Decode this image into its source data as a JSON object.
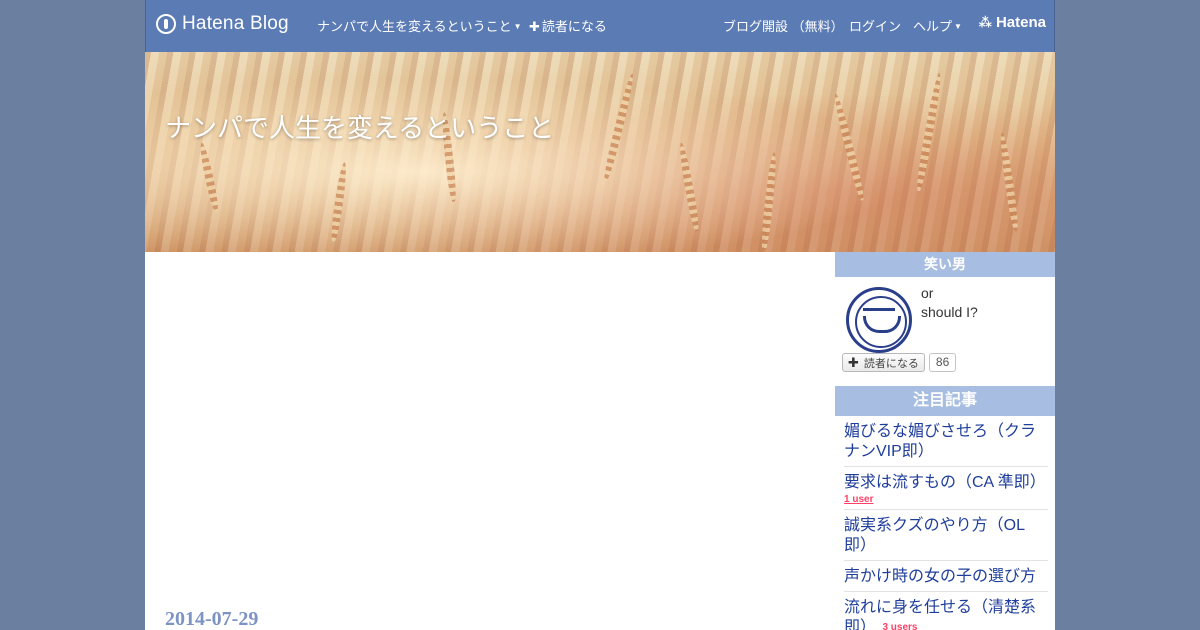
{
  "topbar": {
    "brand": "Hatena Blog",
    "blog_menu": "ナンパで人生を変えるということ",
    "subscribe": "読者になる",
    "start_blog": "ブログ開設 （無料）",
    "login": "ログイン",
    "help": "ヘルプ",
    "hatena": "Hatena"
  },
  "header": {
    "title": "ナンパで人生を変えるということ"
  },
  "main": {
    "date": "2014-07-29"
  },
  "sidebar": {
    "profile": {
      "title": "笑い男",
      "desc_line1": "or",
      "desc_line2": "should I?",
      "subscribe_label": "読者になる",
      "subscriber_count": "86"
    },
    "entries": {
      "title": "注目記事",
      "items": [
        {
          "title": "媚びるな媚びさせろ（クラナンVIP即）",
          "users": ""
        },
        {
          "title": "要求は流すもの（CA 準即）",
          "users": "1 user"
        },
        {
          "title": "誠実系クズのやり方（OL即）",
          "users": ""
        },
        {
          "title": "声かけ時の女の子の選び方",
          "users": ""
        },
        {
          "title": "流れに身を任せる（清楚系即）",
          "users": "3 users"
        }
      ]
    }
  },
  "colors": {
    "topbar": "#5b7bb5",
    "background": "#6b7fa0",
    "sidebar_title": "#a7bde2",
    "link": "#1f3e9b",
    "date": "#7c93c4",
    "users_badge": "#ff4166"
  }
}
